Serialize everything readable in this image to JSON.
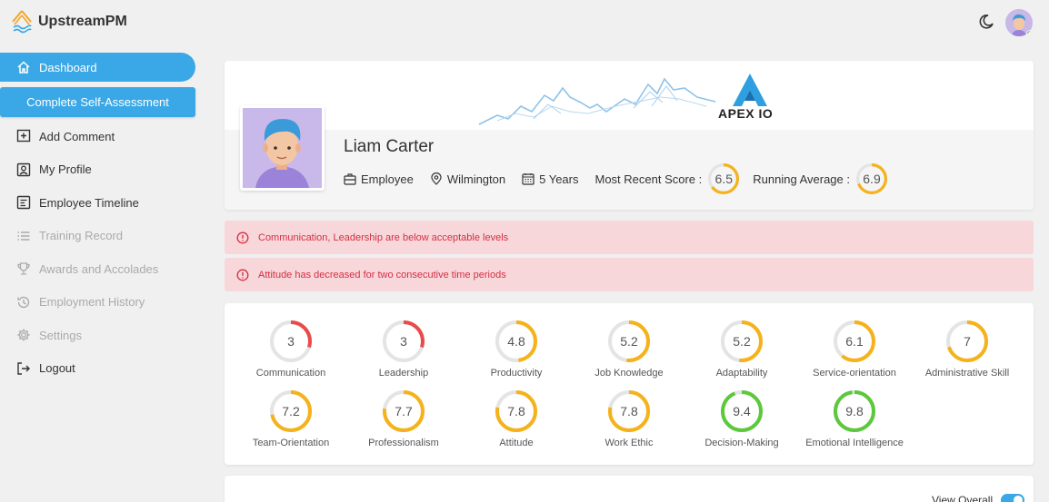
{
  "app": {
    "name": "UpstreamPM"
  },
  "sidebar": {
    "items": [
      {
        "label": "Dashboard",
        "icon": "home-icon",
        "state": "active"
      },
      {
        "label": "Complete Self-Assessment",
        "icon": "",
        "state": "button"
      },
      {
        "label": "Add Comment",
        "icon": "add-comment-icon",
        "state": "enabled"
      },
      {
        "label": "My Profile",
        "icon": "profile-icon",
        "state": "enabled"
      },
      {
        "label": "Employee Timeline",
        "icon": "timeline-icon",
        "state": "enabled"
      },
      {
        "label": "Training Record",
        "icon": "list-icon",
        "state": "disabled"
      },
      {
        "label": "Awards and Accolades",
        "icon": "trophy-icon",
        "state": "disabled"
      },
      {
        "label": "Employment History",
        "icon": "history-icon",
        "state": "disabled"
      },
      {
        "label": "Settings",
        "icon": "gear-icon",
        "state": "disabled"
      },
      {
        "label": "Logout",
        "icon": "logout-icon",
        "state": "enabled"
      }
    ]
  },
  "profile": {
    "company_logo": "APEX IO",
    "name": "Liam Carter",
    "role": "Employee",
    "location": "Wilmington",
    "tenure": "5 Years",
    "recent_score_label": "Most Recent Score :",
    "recent_score": "6.5",
    "running_avg_label": "Running Average :",
    "running_avg": "6.9"
  },
  "alerts": [
    "Communication, Leadership are below acceptable levels",
    "Attitude has decreased for two consecutive time periods"
  ],
  "metrics": [
    {
      "label": "Communication",
      "score": "3"
    },
    {
      "label": "Leadership",
      "score": "3"
    },
    {
      "label": "Productivity",
      "score": "4.8"
    },
    {
      "label": "Job Knowledge",
      "score": "5.2"
    },
    {
      "label": "Adaptability",
      "score": "5.2"
    },
    {
      "label": "Service-orientation",
      "score": "6.1"
    },
    {
      "label": "Administrative Skill",
      "score": "7"
    },
    {
      "label": "Team-Orientation",
      "score": "7.2"
    },
    {
      "label": "Professionalism",
      "score": "7.7"
    },
    {
      "label": "Attitude",
      "score": "7.8"
    },
    {
      "label": "Work Ethic",
      "score": "7.8"
    },
    {
      "label": "Decision-Making",
      "score": "9.4"
    },
    {
      "label": "Emotional Intelligence",
      "score": "9.8"
    }
  ],
  "bottom": {
    "view_overall_label": "View Overall"
  },
  "colors": {
    "accent": "#3aa8e6",
    "low": "#e94b4b",
    "mid": "#f5b21a",
    "high": "#5cc83b",
    "alert_bg": "#f8d7da",
    "alert_text": "#d32f45"
  }
}
